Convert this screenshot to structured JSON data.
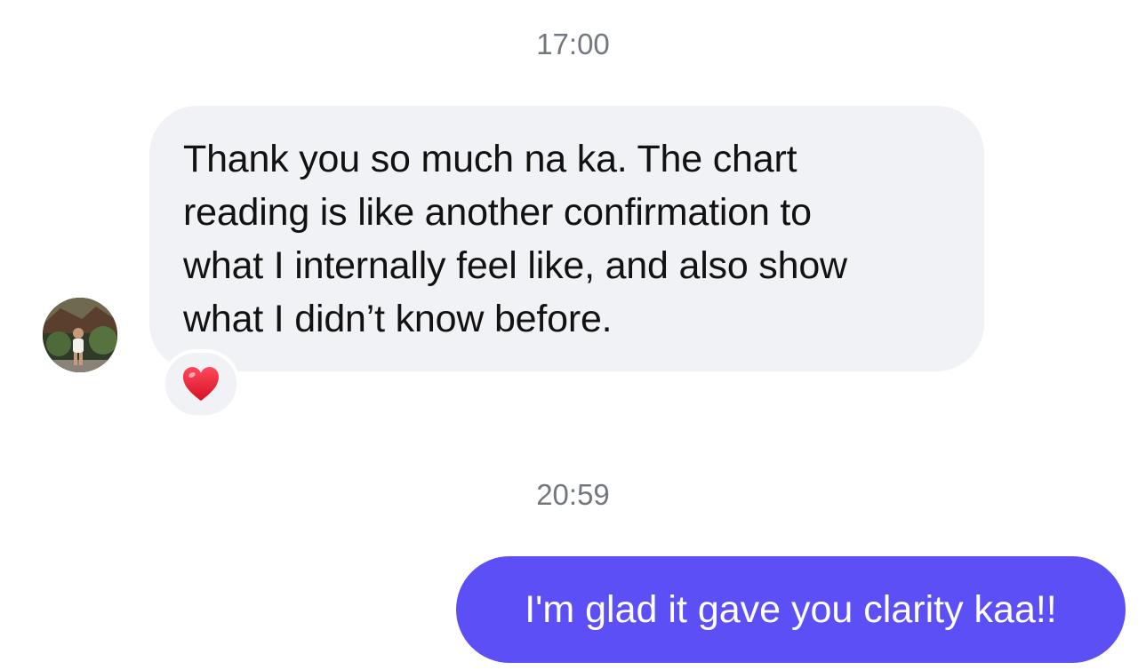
{
  "conversation": {
    "timestamps": [
      "17:00",
      "20:59"
    ],
    "incoming": {
      "lines": [
        "Thank you so much na ka. The chart",
        "reading is like another confirmation to",
        "what I internally feel like, and also show",
        "what I didn’t know before."
      ],
      "reaction": "heart-icon",
      "bubble_color": "#f1f2f6"
    },
    "outgoing": {
      "text": "I'm glad it gave you clarity kaa!!",
      "bubble_color": "#5b4ff5"
    }
  },
  "colors": {
    "timestamp": "#737780",
    "incoming_text": "#121212",
    "outgoing_text": "#ffffff",
    "reaction_heart": "#e8112d"
  }
}
